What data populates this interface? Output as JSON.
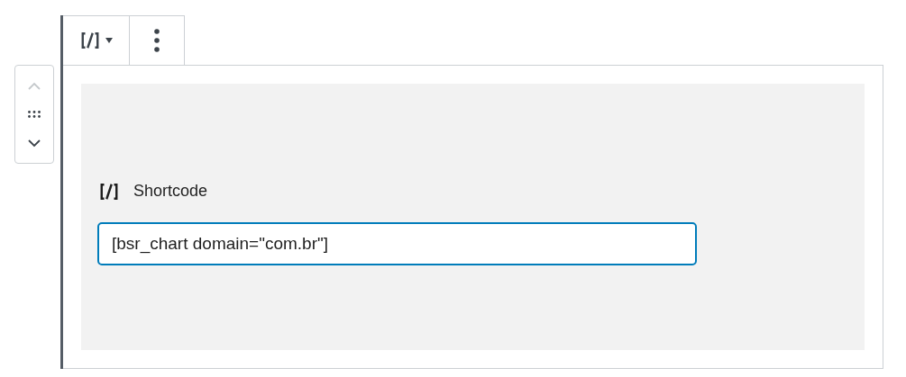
{
  "mover": [
    {
      "kind": "up",
      "disabled": true
    },
    {
      "kind": "drag",
      "disabled": false
    },
    {
      "kind": "down",
      "disabled": false
    }
  ],
  "block": {
    "label": "Shortcode",
    "value": "[bsr_chart domain=\"com.br\"]",
    "focused": true
  }
}
